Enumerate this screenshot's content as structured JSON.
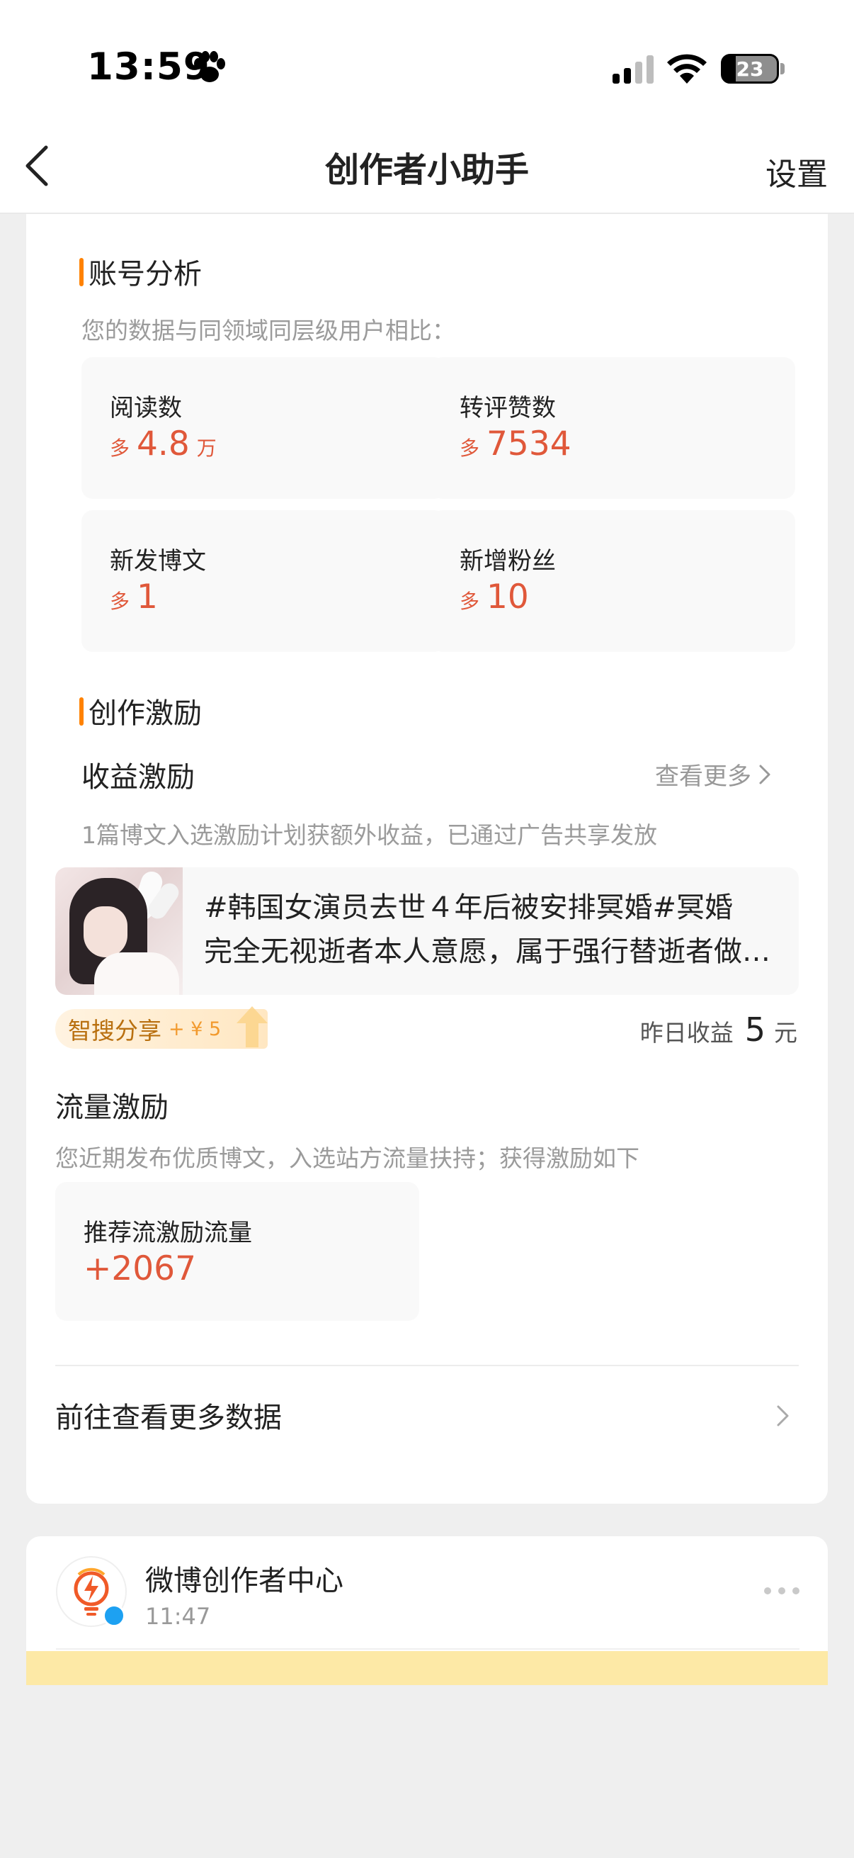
{
  "status": {
    "time": "13:59",
    "battery": "23"
  },
  "nav": {
    "title": "创作者小助手",
    "settings": "设置"
  },
  "account_analysis": {
    "title": "账号分析",
    "subtitle": "您的数据与同领域同层级用户相比：",
    "stats": [
      {
        "label": "阅读数",
        "prefix": "多",
        "value": "4.8",
        "unit": "万"
      },
      {
        "label": "转评赞数",
        "prefix": "多",
        "value": "7534",
        "unit": ""
      },
      {
        "label": "新发博文",
        "prefix": "多",
        "value": "1",
        "unit": ""
      },
      {
        "label": "新增粉丝",
        "prefix": "多",
        "value": "10",
        "unit": ""
      }
    ]
  },
  "creation_incentive": {
    "title": "创作激励",
    "revenue": {
      "title": "收益激励",
      "see_more": "查看更多",
      "desc": "1篇博文入选激励计划获额外收益，已通过广告共享发放",
      "post_line1": "#韩国女演员去世４年后被安排冥婚#冥婚",
      "post_line2": "完全无视逝者本人意愿，属于强行替逝者做决定",
      "tag_label": "智搜分享",
      "tag_amount": "+ ¥ 5",
      "yesterday_label": "昨日收益",
      "yesterday_value": "5",
      "yesterday_unit": "元"
    },
    "traffic": {
      "title": "流量激励",
      "desc": "您近期发布优质博文，入选站方流量扶持；获得激励如下",
      "box_label": "推荐流激励流量",
      "box_value": "+2067"
    },
    "more_data": "前往查看更多数据"
  },
  "message": {
    "name": "微博创作者中心",
    "time": "11:47"
  },
  "colors": {
    "accent": "#ff8200",
    "value_red": "#e0583a",
    "background": "#efefef"
  }
}
